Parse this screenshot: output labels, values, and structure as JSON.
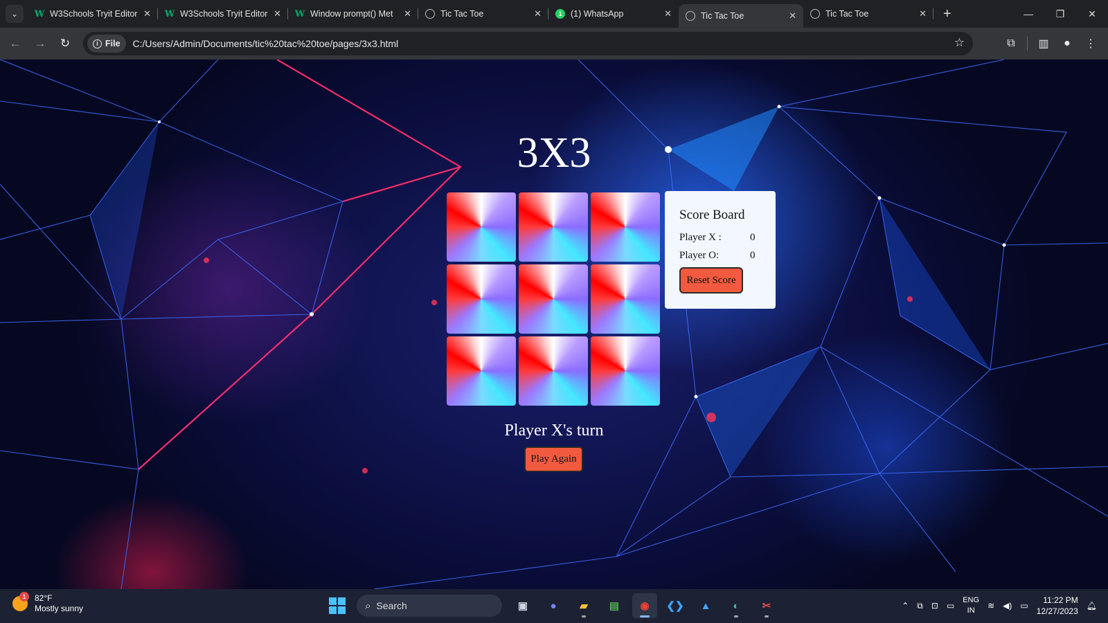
{
  "browser": {
    "tabs": [
      {
        "title": "W3Schools Tryit Editor",
        "favicon": "w3schools-icon",
        "active": false
      },
      {
        "title": "W3Schools Tryit Editor",
        "favicon": "w3schools-icon",
        "active": false
      },
      {
        "title": "Window prompt() Met",
        "favicon": "w3schools-icon",
        "active": false
      },
      {
        "title": "Tic Tac Toe",
        "favicon": "globe-icon",
        "active": false
      },
      {
        "title": "(1) WhatsApp",
        "favicon": "whatsapp-icon",
        "active": false
      },
      {
        "title": "Tic Tac Toe",
        "favicon": "globe-icon",
        "active": true
      },
      {
        "title": "Tic Tac Toe",
        "favicon": "globe-icon",
        "active": false
      }
    ],
    "whatsapp_badge": "1",
    "address": {
      "chip_label": "File",
      "url": "C:/Users/Admin/Documents/tic%20tac%20toe/pages/3x3.html"
    }
  },
  "game": {
    "heading": "3X3",
    "cells": [
      "",
      "",
      "",
      "",
      "",
      "",
      "",
      "",
      ""
    ],
    "turn_text": "Player X's turn",
    "play_again_label": "Play Again"
  },
  "scoreboard": {
    "title": "Score Board",
    "player_x_label": "Player X :",
    "player_x_score": "0",
    "player_o_label": "Player O:",
    "player_o_score": "0",
    "reset_label": "Reset Score"
  },
  "taskbar": {
    "weather_temp": "82°F",
    "weather_desc": "Mostly sunny",
    "weather_badge": "1",
    "search_placeholder": "Search",
    "lang_line1": "ENG",
    "lang_line2": "IN",
    "time": "11:22 PM",
    "date": "12/27/2023"
  },
  "colors": {
    "accent_button": "#f15a3f",
    "scoreboard_bg": "#f3f7ff",
    "tab_active": "#35363a",
    "tabstrip": "#202124"
  }
}
